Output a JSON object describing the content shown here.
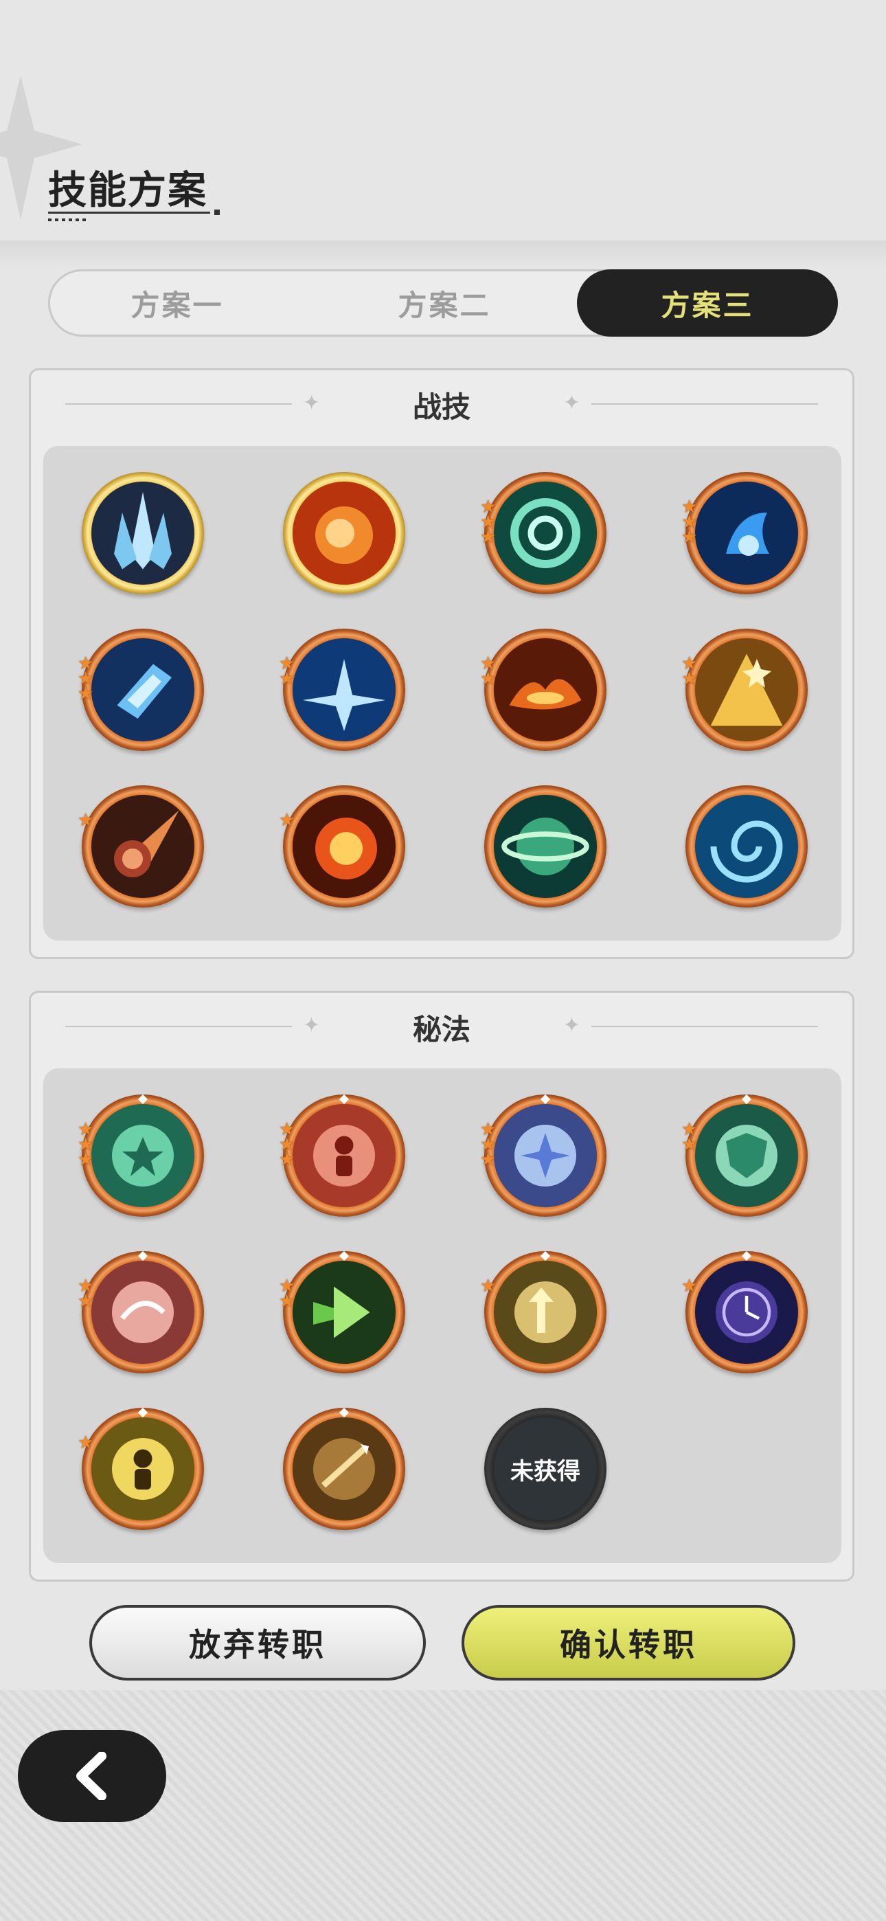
{
  "header": {
    "title": "技能方案"
  },
  "tabs": [
    {
      "label": "方案一",
      "active": false
    },
    {
      "label": "方案二",
      "active": false
    },
    {
      "label": "方案三",
      "active": true
    }
  ],
  "sections": {
    "combat": {
      "title": "战技"
    },
    "secret": {
      "title": "秘法"
    }
  },
  "locked_label": "未获得",
  "buttons": {
    "abandon": "放弃转职",
    "confirm": "确认转职"
  },
  "colors": {
    "tab_active_bg": "#222222",
    "tab_active_text": "#e4e07a",
    "confirm_bg": "#d8dc5a",
    "star": "#f08a2c"
  }
}
